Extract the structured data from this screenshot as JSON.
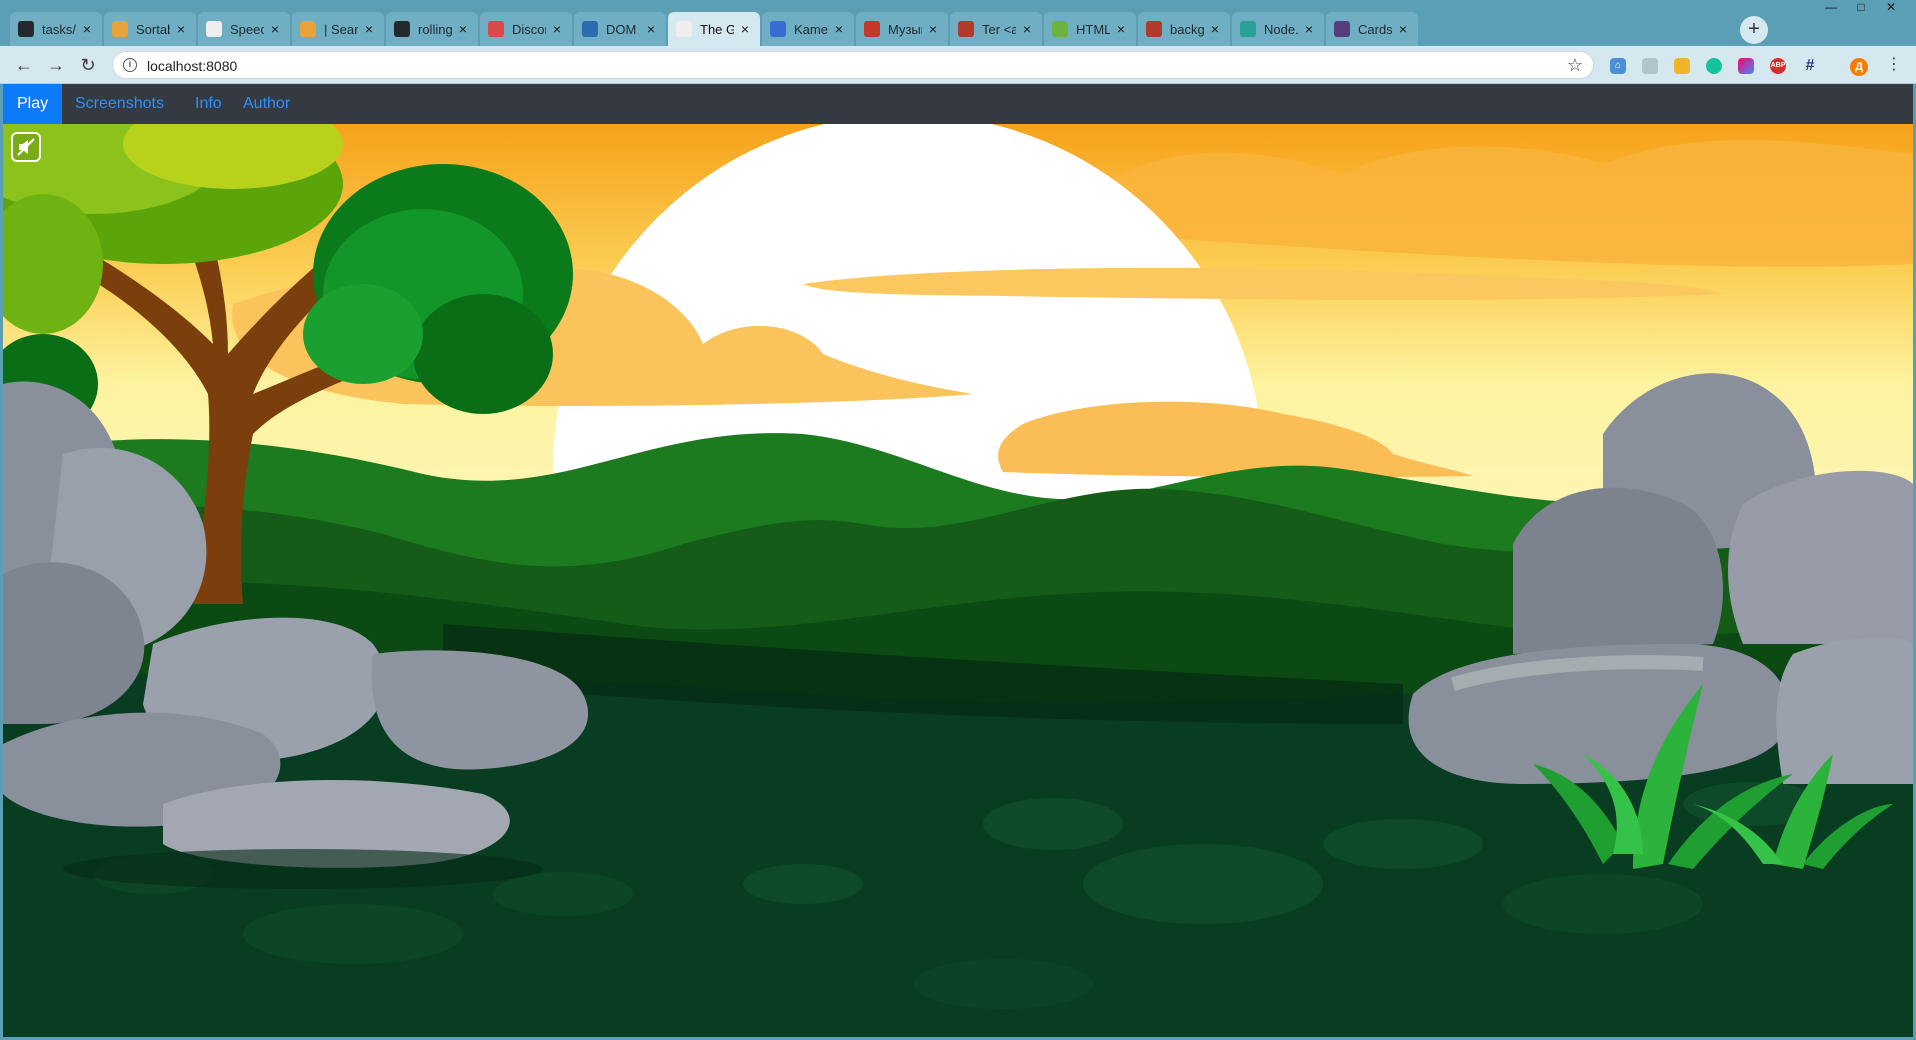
{
  "browser": {
    "tabs": [
      {
        "title": "tasks/gar",
        "icon": "github-icon",
        "color": "#24292e"
      },
      {
        "title": "Sortable",
        "icon": "ublock-icon",
        "color": "#e8a33b"
      },
      {
        "title": "Speech sy",
        "icon": "page-icon",
        "color": "#eeeeee"
      },
      {
        "title": "| Search f",
        "icon": "ublock-icon",
        "color": "#e8a33b"
      },
      {
        "title": "rolling-sc",
        "icon": "github-icon",
        "color": "#24292e"
      },
      {
        "title": "Discord",
        "icon": "discord-icon",
        "color": "#d84a4a"
      },
      {
        "title": "DOM Rep",
        "icon": "wave-icon",
        "color": "#2b6cb0"
      },
      {
        "title": "The Game",
        "icon": "page-icon",
        "color": "#eeeeee"
      },
      {
        "title": "Kame",
        "icon": "play-icon",
        "color": "#3d6bd6"
      },
      {
        "title": "Музыка",
        "icon": "music-icon",
        "color": "#c0392b"
      },
      {
        "title": "Ter <audi",
        "icon": "blocks-icon",
        "color": "#b03a2e"
      },
      {
        "title": "HTML Au",
        "icon": "w3-icon",
        "color": "#6cb33e"
      },
      {
        "title": "backgrou",
        "icon": "blocks-icon",
        "color": "#b03a2e"
      },
      {
        "title": "Node.js |",
        "icon": "h-icon",
        "color": "#2aa198"
      },
      {
        "title": "Cards · B",
        "icon": "bootstrap-icon",
        "color": "#563d7c"
      }
    ],
    "active_tab_index": 7,
    "url": "localhost:8080"
  },
  "navbar": {
    "links": [
      {
        "label": "Play",
        "active": true
      },
      {
        "label": "Screenshots",
        "active": false
      },
      {
        "label": "Info",
        "active": false
      },
      {
        "label": "Author",
        "active": false
      }
    ]
  },
  "colors": {
    "navbar_bg": "#343a40",
    "active_link": "#0d7bf7",
    "link": "#2f8fff",
    "sky_top": "#f6a21a",
    "sky_bottom": "#fdf3a0",
    "ground": "#083d22"
  }
}
